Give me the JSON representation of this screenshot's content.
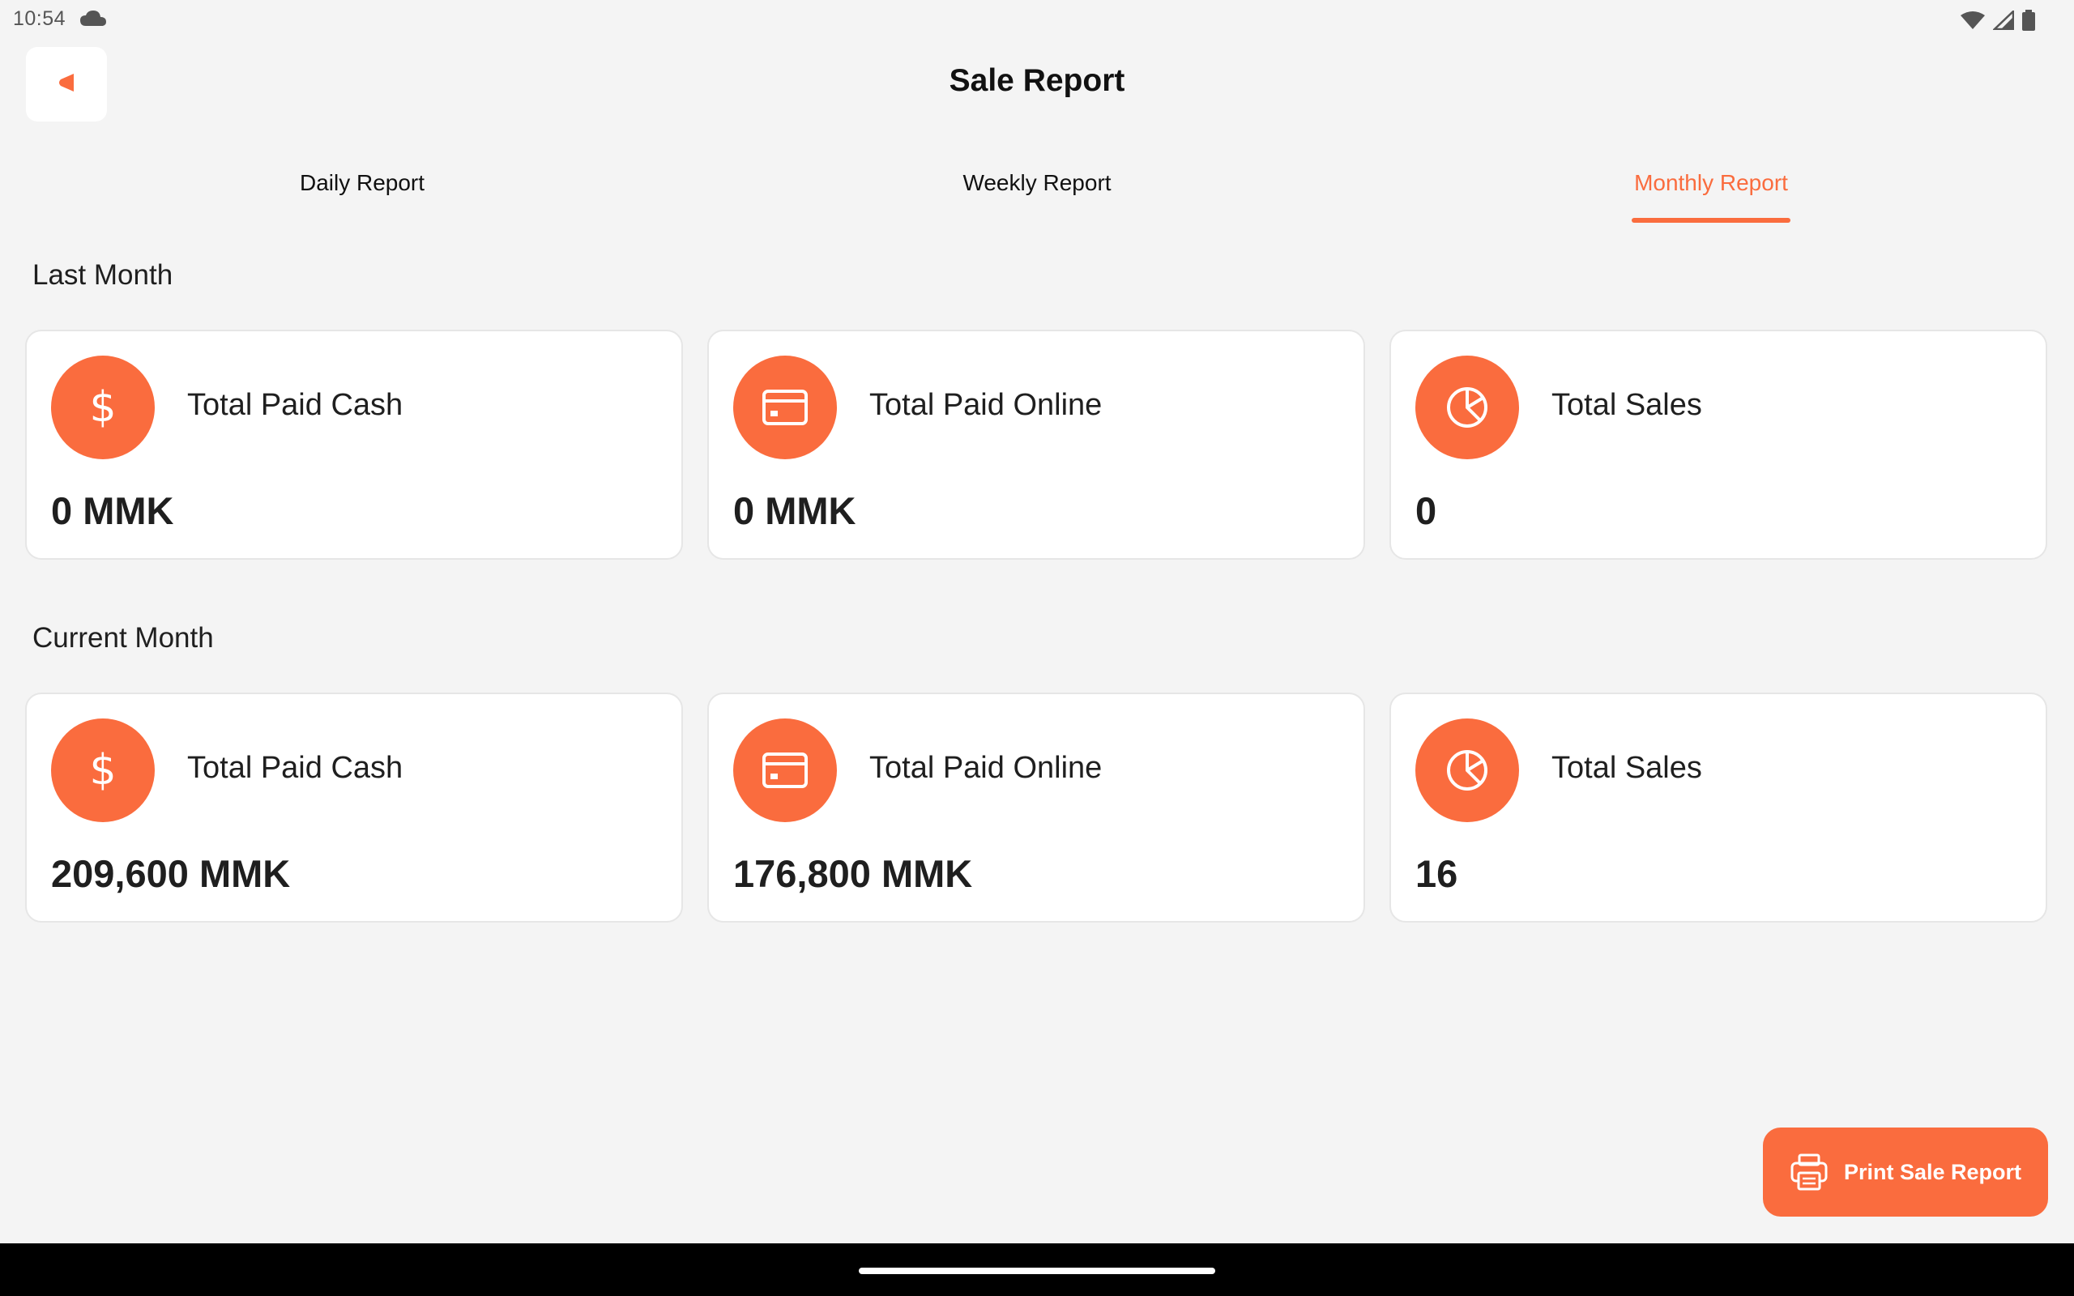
{
  "status_bar": {
    "time": "10:54",
    "icons": [
      "cloud-icon",
      "wifi-icon",
      "signal-icon",
      "battery-icon"
    ]
  },
  "header": {
    "title": "Sale Report",
    "back_icon": "back-arrow-icon"
  },
  "tabs": [
    {
      "label": "Daily Report",
      "selected": false
    },
    {
      "label": "Weekly Report",
      "selected": false
    },
    {
      "label": "Monthly Report",
      "selected": true
    }
  ],
  "sections": [
    {
      "title": "Last Month",
      "cards": [
        {
          "icon": "dollar-icon",
          "label": "Total Paid Cash",
          "value": "0 MMK"
        },
        {
          "icon": "credit-card-icon",
          "label": "Total Paid Online",
          "value": "0 MMK"
        },
        {
          "icon": "pie-chart-icon",
          "label": "Total Sales",
          "value": "0"
        }
      ]
    },
    {
      "title": "Current Month",
      "cards": [
        {
          "icon": "dollar-icon",
          "label": "Total Paid Cash",
          "value": "209,600 MMK"
        },
        {
          "icon": "credit-card-icon",
          "label": "Total Paid Online",
          "value": "176,800 MMK"
        },
        {
          "icon": "pie-chart-icon",
          "label": "Total Sales",
          "value": "16"
        }
      ]
    }
  ],
  "print_button": {
    "label": "Print Sale Report",
    "icon": "printer-icon"
  },
  "colors": {
    "accent": "#fa6c3e",
    "background": "#f4f4f4",
    "card": "#ffffff"
  }
}
